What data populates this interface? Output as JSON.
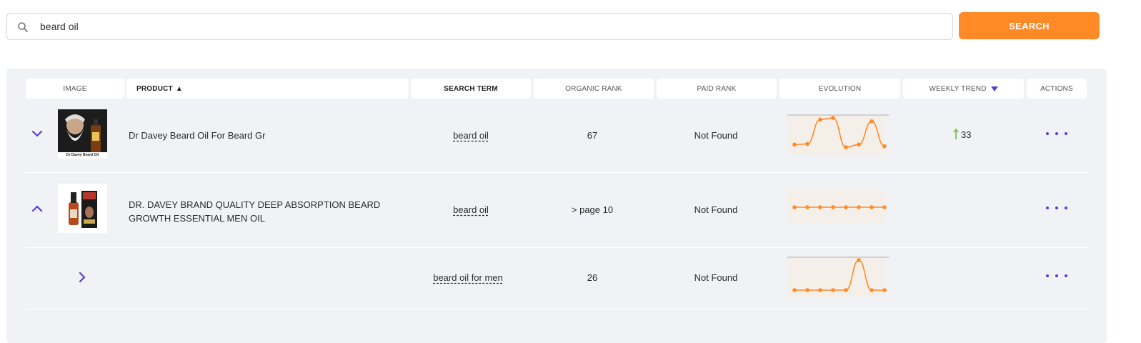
{
  "search": {
    "value": "beard oil",
    "placeholder": "",
    "button_label": "SEARCH"
  },
  "table": {
    "headers": {
      "image": "IMAGE",
      "product": "PRODUCT",
      "product_sort_arrow": "▲",
      "search_term": "SEARCH TERM",
      "organic_rank": "ORGANIC RANK",
      "paid_rank": "PAID RANK",
      "evolution": "EVOLUTION",
      "weekly_trend": "WEEKLY TREND",
      "actions": "ACTIONS"
    },
    "rows": [
      {
        "expand_icon": "chevron-down-icon",
        "thumbnail_caption": "Dr Davey Beard Oil",
        "product": "Dr Davey Beard Oil For Beard Gr",
        "search_term": "beard oil",
        "organic_rank": "67",
        "paid_rank": "Not Found",
        "evolution": [
          10,
          12,
          85,
          90,
          2,
          10,
          80,
          5
        ],
        "weekly_trend": {
          "direction": "up",
          "value": "33",
          "color": "#7bc24a"
        }
      },
      {
        "expand_icon": "chevron-up-icon",
        "product_line1": "DR. DAVEY BRAND QUALITY DEEP ABSORPTION BEARD",
        "product_line2": "GROWTH ESSENTIAL MEN OIL",
        "search_term": "beard oil",
        "organic_rank": "> page 10",
        "paid_rank": "Not Found",
        "evolution": [
          0,
          0,
          0,
          0,
          0,
          0,
          0,
          0
        ],
        "weekly_trend": null
      },
      {
        "expand_icon": "chevron-right-icon",
        "search_term": "beard oil for men",
        "organic_rank": "26",
        "paid_rank": "Not Found",
        "evolution": [
          0,
          0,
          0,
          0,
          0,
          100,
          0,
          0
        ],
        "weekly_trend": null
      }
    ]
  },
  "colors": {
    "accent": "#ff8a26",
    "purple": "#5b3bd6",
    "panel": "#f0f2f6",
    "spark_bg": "#f5efea"
  }
}
